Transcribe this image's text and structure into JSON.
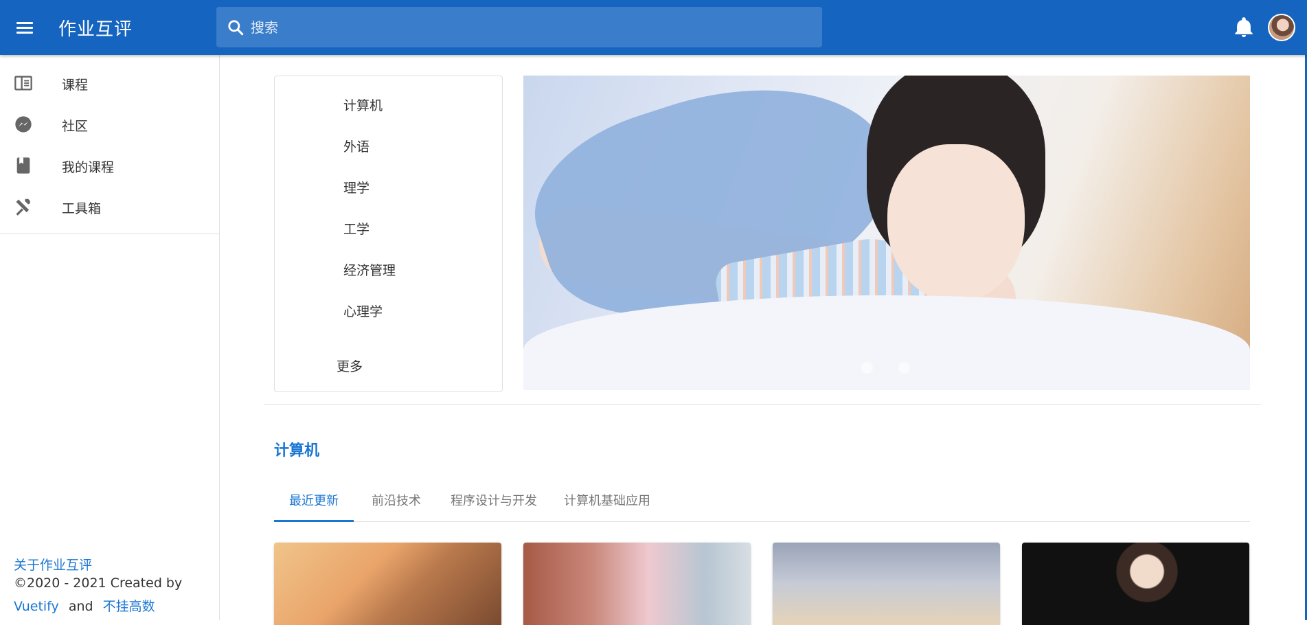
{
  "app": {
    "title": "作业互评",
    "search_placeholder": "搜索"
  },
  "sidebar": {
    "items": [
      {
        "label": "课程",
        "icon": "book-open-page-icon"
      },
      {
        "label": "社区",
        "icon": "messenger-icon"
      },
      {
        "label": "我的课程",
        "icon": "book-icon"
      },
      {
        "label": "工具箱",
        "icon": "tools-icon"
      }
    ],
    "footer": {
      "about_link": "关于作业互评",
      "copyright": "©2020 - 2021 Created by",
      "vuetify_link": "Vuetify",
      "and": "and",
      "author_link": "不挂高数"
    }
  },
  "categories": [
    "计算机",
    "外语",
    "理学",
    "工学",
    "经济管理",
    "心理学"
  ],
  "categories_more": "更多",
  "carousel": {
    "slide_count": 2,
    "active_index": 0
  },
  "section": {
    "title": "计算机",
    "tabs": [
      "最近更新",
      "前沿技术",
      "程序设计与开发",
      "计算机基础应用"
    ],
    "active_tab": 0
  },
  "colors": {
    "primary": "#1565c0",
    "accent": "#1976d2",
    "text": "#333333"
  }
}
